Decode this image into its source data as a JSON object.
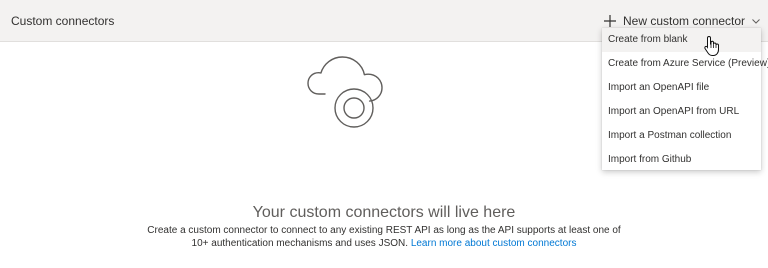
{
  "header": {
    "title": "Custom connectors",
    "new_button_label": "New custom connector",
    "new_button_icon": "plus-icon",
    "dropdown_icon": "chevron-down-icon"
  },
  "menu": {
    "items": [
      {
        "label": "Create from blank"
      },
      {
        "label": "Create from Azure Service (Preview)"
      },
      {
        "label": "Import an OpenAPI file"
      },
      {
        "label": "Import an OpenAPI from URL"
      },
      {
        "label": "Import a Postman collection"
      },
      {
        "label": "Import from Github"
      }
    ]
  },
  "empty_state": {
    "illustration": "cloud-icon",
    "title": "Your custom connectors will live here",
    "description": "Create a custom connector to connect to any existing REST API as long as the API supports at least one of 10+ authentication mechanisms and uses JSON.",
    "link_label": "Learn more about custom connectors"
  },
  "colors": {
    "header_bg": "#f3f2f1",
    "link": "#0078d4",
    "text": "#323130"
  }
}
